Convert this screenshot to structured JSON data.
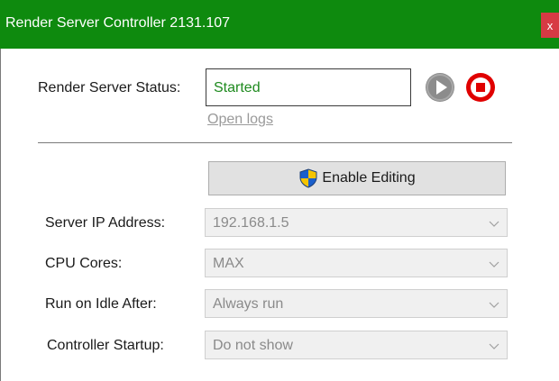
{
  "window": {
    "title": "Render Server Controller 2131.107",
    "close_glyph": "x",
    "titlebar_color": "#0e8a0e"
  },
  "status": {
    "label": "Render Server Status:",
    "value": "Started",
    "value_color": "#1e8a1e",
    "open_logs": "Open logs",
    "play_icon": "play-icon",
    "stop_icon": "stop-icon"
  },
  "enable_editing": {
    "label": "Enable Editing",
    "icon": "uac-shield-icon"
  },
  "settings": [
    {
      "label": "Server IP Address:",
      "value": "192.168.1.5"
    },
    {
      "label": "CPU Cores:",
      "value": "MAX"
    },
    {
      "label": "Run on Idle After:",
      "value": "Always run"
    },
    {
      "label": "Controller Startup:",
      "value": "Do not show"
    }
  ]
}
